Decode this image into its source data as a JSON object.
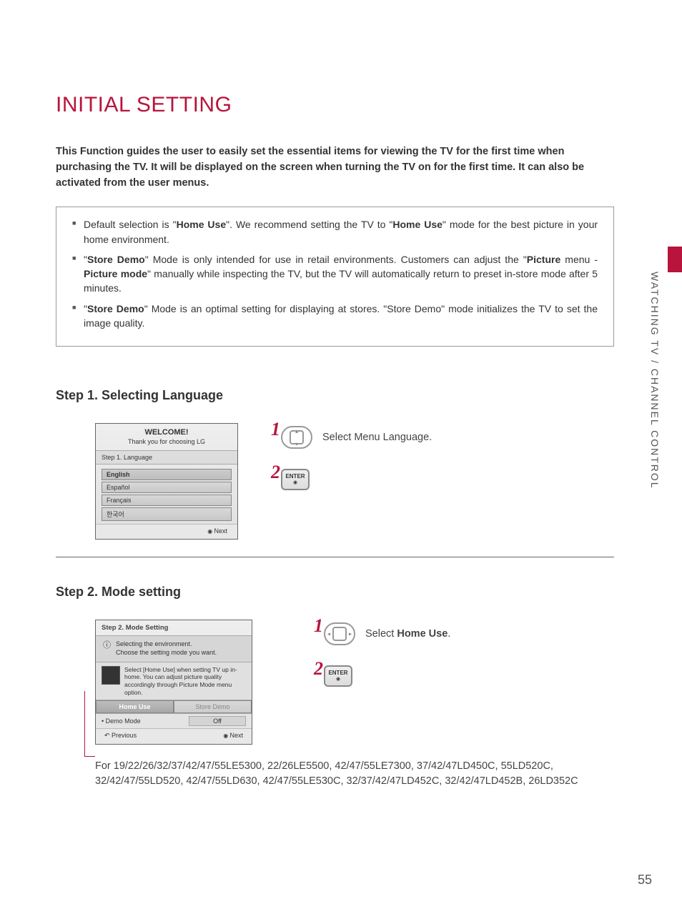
{
  "sideLabel": "WATCHING TV / CHANNEL CONTROL",
  "pageNumber": "55",
  "title": "INITIAL SETTING",
  "intro": "This Function guides the user to easily set the essential items for viewing the TV for the first time when purchasing the TV. It will be displayed on the screen when turning the TV on for the first time. It can also be activated from the user menus.",
  "notes": {
    "n1_pre": "Default selection is \"",
    "n1_b1": "Home Use",
    "n1_mid": "\". We recommend setting the TV to \"",
    "n1_b2": "Home Use",
    "n1_post": "\" mode for the best picture in your home environment.",
    "n2_pre": "\"",
    "n2_b1": "Store Demo",
    "n2_mid1": "\" Mode is only intended for use in retail environments. Customers can adjust the \"",
    "n2_b2": "Picture",
    "n2_mid2": " menu - ",
    "n2_b3": "Picture mode",
    "n2_post": "\" manually while inspecting the TV, but the TV will automatically return to preset in-store mode after 5 minutes.",
    "n3_pre": "\"",
    "n3_b1": "Store Demo",
    "n3_post": "\" Mode is an optimal setting for displaying at stores. \"Store Demo\" mode initializes the TV to set the image quality."
  },
  "step1": {
    "heading": "Step 1. Selecting Language",
    "dialog": {
      "welcome": "WELCOME!",
      "sub": "Thank you for choosing LG",
      "stepLabel": "Step 1. Language",
      "options": [
        "English",
        "Español",
        "Français",
        "한국어"
      ],
      "next": "Next"
    },
    "instr": {
      "num1": "1",
      "num2": "2",
      "text1": "Select Menu Language.",
      "enterLabel": "ENTER"
    }
  },
  "step2": {
    "heading": "Step 2. Mode setting",
    "dialog": {
      "stepLabel": "Step 2. Mode Setting",
      "info1a": "Selecting the environment.",
      "info1b": "Choose the setting mode you want.",
      "info2": "Select [Home Use] when setting TV up in-home. You can adjust picture quality accordingly through Picture Mode menu option.",
      "tabHome": "Home Use",
      "tabStore": "Store Demo",
      "demoLabel": "• Demo Mode",
      "demoVal": "Off",
      "prev": "Previous",
      "next": "Next"
    },
    "instr": {
      "num1": "1",
      "num2": "2",
      "text1_pre": "Select ",
      "text1_b": "Home Use",
      "text1_post": ".",
      "enterLabel": "ENTER"
    },
    "models": "For 19/22/26/32/37/42/47/55LE5300, 22/26LE5500, 42/47/55LE7300, 37/42/47LD450C, 55LD520C, 32/42/47/55LD520, 42/47/55LD630, 42/47/55LE530C, 32/37/42/47LD452C, 32/42/47LD452B, 26LD352C"
  }
}
